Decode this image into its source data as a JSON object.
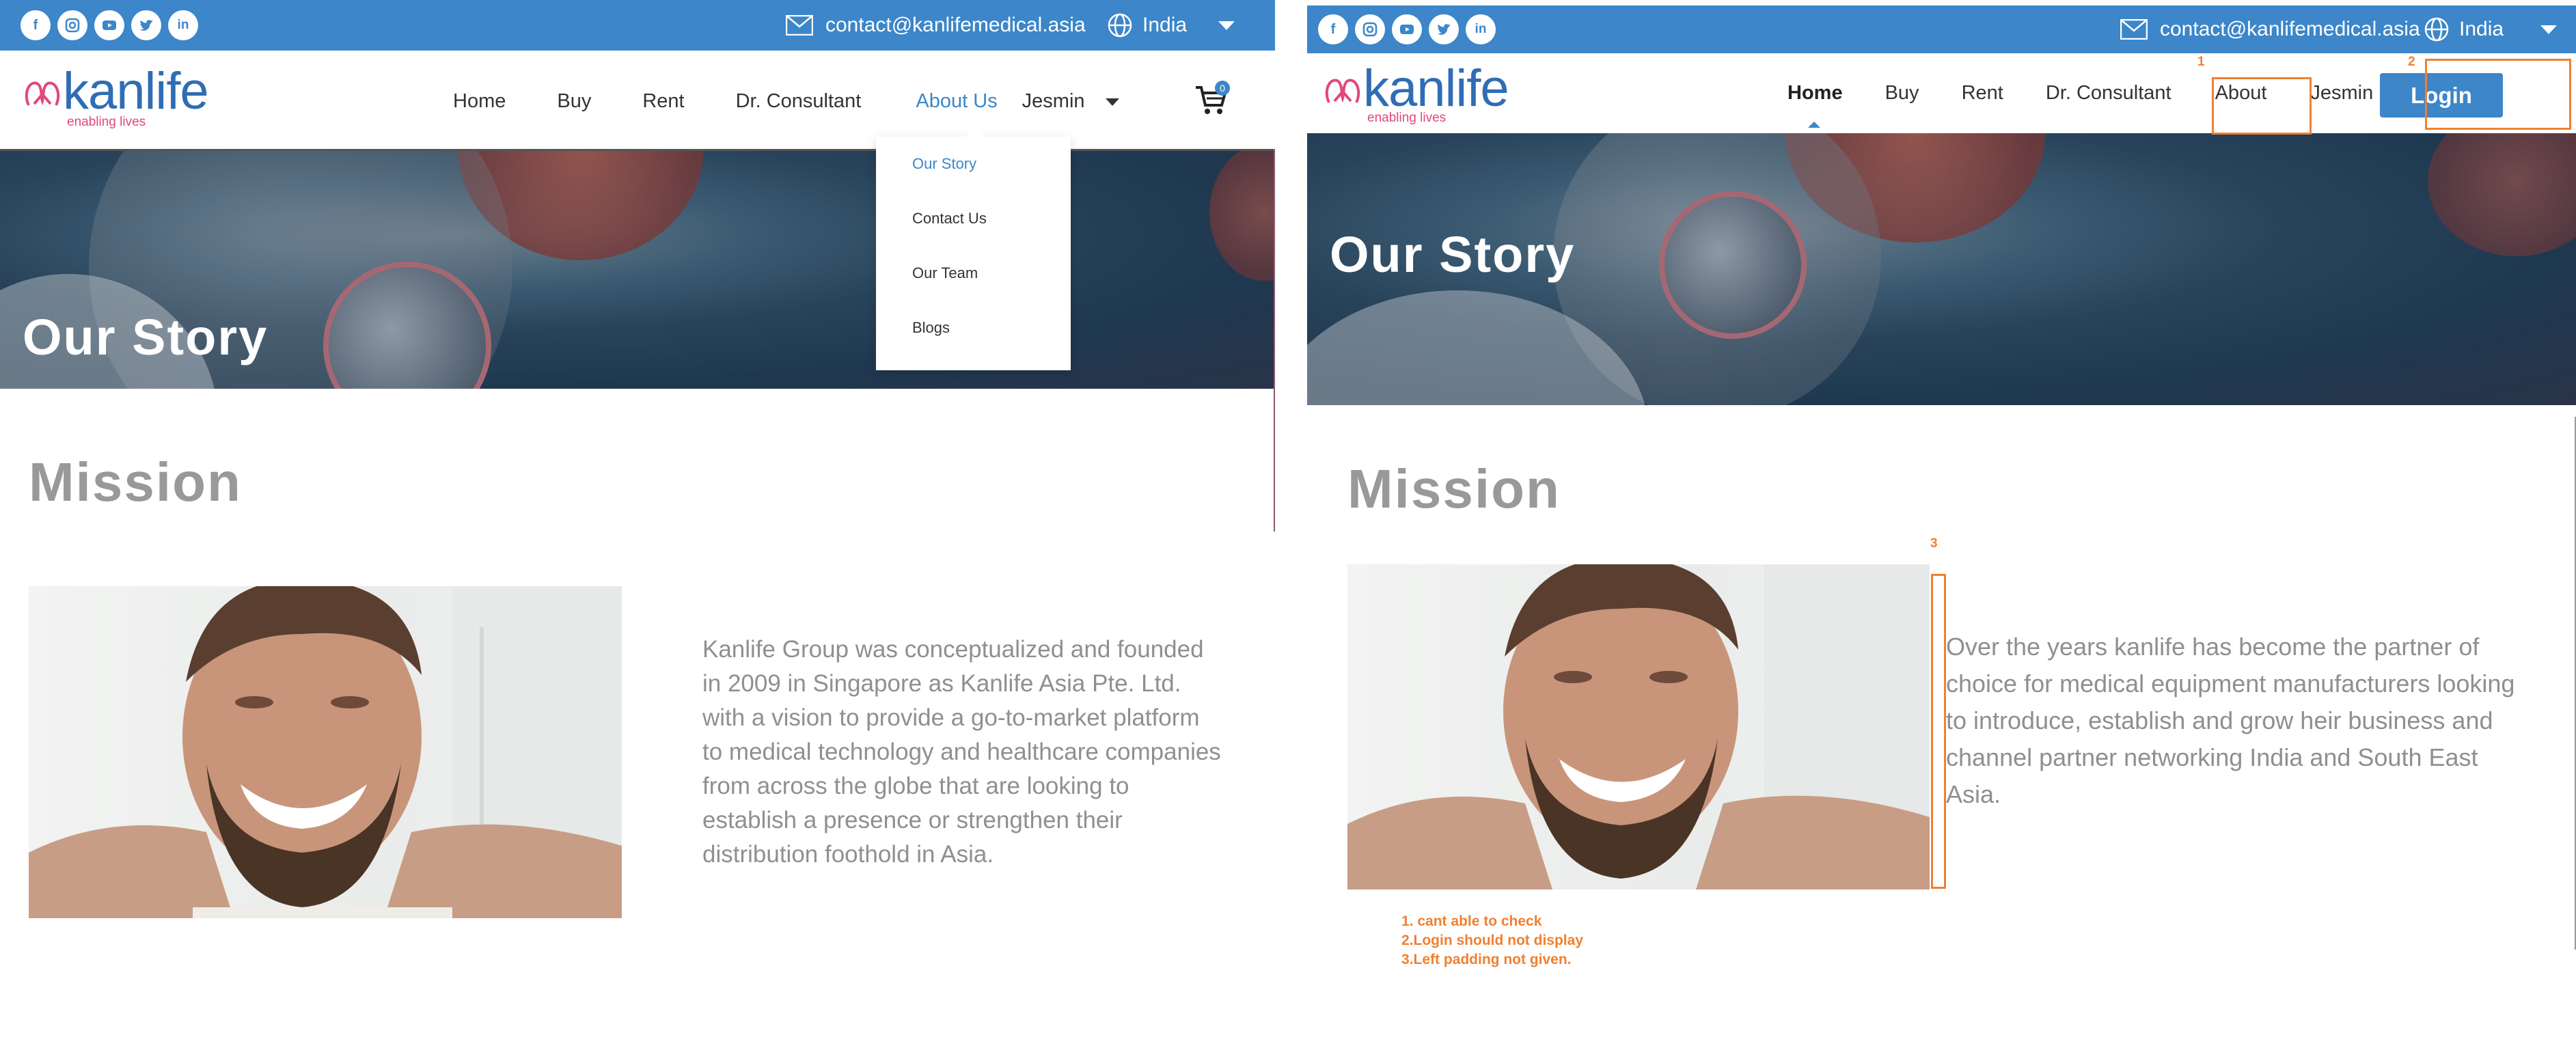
{
  "left": {
    "topbar": {
      "socials": [
        "facebook-icon",
        "instagram-icon",
        "youtube-icon",
        "twitter-icon",
        "linkedin-icon"
      ],
      "email": "contact@kanlifemedical.asia",
      "country": "India"
    },
    "logo": {
      "word_k": "kan",
      "word_rest": "life",
      "tagline": "enabling lives"
    },
    "nav": {
      "home": "Home",
      "buy": "Buy",
      "rent": "Rent",
      "consultant": "Dr. Consultant",
      "about": "About Us",
      "user": "Jesmin",
      "cart_count": "0"
    },
    "dropdown": [
      "Our Story",
      "Contact Us",
      "Our Team",
      "Blogs"
    ],
    "hero_title": "Our Story",
    "mission_heading": "Mission",
    "body_text": "Kanlife Group was conceptualized and founded in 2009 in Singapore as Kanlife Asia Pte. Ltd. with a vision to provide a go-to-market platform to medical technology and healthcare companies from across the globe that are looking to establish a presence or strengthen their distribution foothold in Asia."
  },
  "right": {
    "topbar": {
      "socials": [
        "facebook-icon",
        "instagram-icon",
        "youtube-icon",
        "twitter-icon",
        "linkedin-icon"
      ],
      "email": "contact@kanlifemedical.asia",
      "country": "India"
    },
    "logo": {
      "word_k": "kan",
      "word_rest": "life",
      "tagline": "enabling lives"
    },
    "nav": {
      "home": "Home",
      "buy": "Buy",
      "rent": "Rent",
      "consultant": "Dr. Consultant",
      "about": "About",
      "user": "Jesmin",
      "login": "Login"
    },
    "hero_title": "Our Story",
    "mission_heading": "Mission",
    "body_text": "Over the years kanlife has become the partner of choice for medical equipment manufacturers looking to introduce, establish and grow heir business and channel partner networking India and South East Asia.",
    "annotations": {
      "marker_1": "1",
      "marker_2": "2",
      "marker_3": "3",
      "note_1": "1. cant able to check",
      "note_2": "2.Login should not display",
      "note_3": "3.Left padding not given."
    }
  },
  "colors": {
    "brand_blue": "#3c86c9",
    "brand_pink": "#e2477d",
    "annotation_orange": "#f08030"
  }
}
